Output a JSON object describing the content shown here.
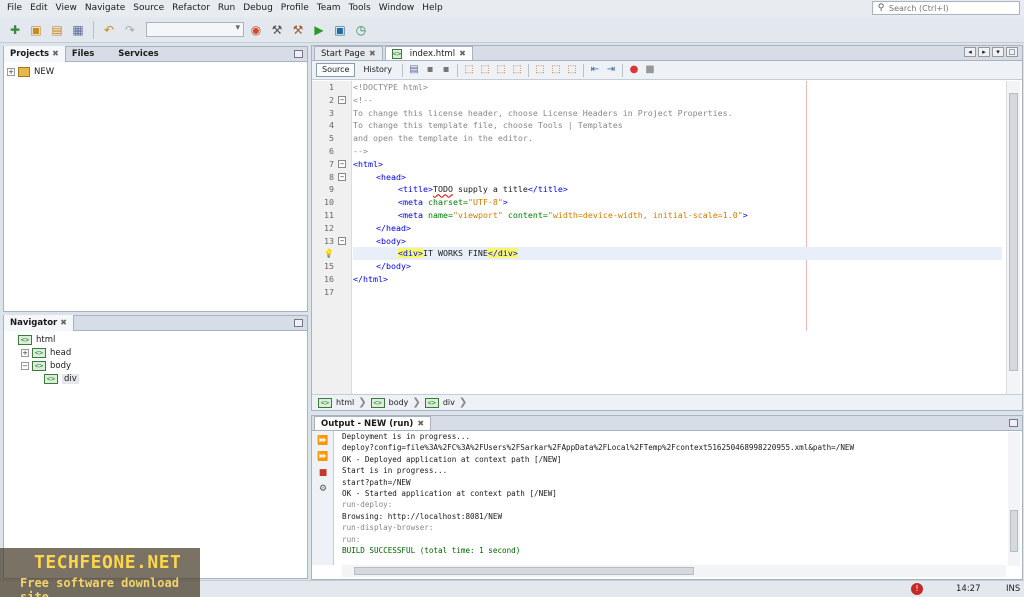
{
  "menu": [
    "File",
    "Edit",
    "View",
    "Navigate",
    "Source",
    "Refactor",
    "Run",
    "Debug",
    "Profile",
    "Team",
    "Tools",
    "Window",
    "Help"
  ],
  "search": {
    "placeholder": "Search (Ctrl+I)"
  },
  "projects_panel": {
    "tabs": [
      "Projects",
      "Files",
      "Services"
    ],
    "tree": [
      {
        "label": "NEW"
      }
    ]
  },
  "navigator": {
    "title": "Navigator",
    "tree": [
      {
        "label": "html"
      },
      {
        "label": "head"
      },
      {
        "label": "body"
      },
      {
        "label": "div"
      }
    ]
  },
  "editor": {
    "tabs": [
      "Start Page",
      "index.html"
    ],
    "active_tab": "index.html",
    "modes": [
      "Source",
      "History"
    ],
    "lines": [
      {
        "n": "1"
      },
      {
        "n": "2"
      },
      {
        "n": "3"
      },
      {
        "n": "4"
      },
      {
        "n": "5"
      },
      {
        "n": "6"
      },
      {
        "n": "7"
      },
      {
        "n": "8"
      },
      {
        "n": "9"
      },
      {
        "n": "10"
      },
      {
        "n": "11"
      },
      {
        "n": "12"
      },
      {
        "n": "13"
      },
      {
        "n": "14"
      },
      {
        "n": "15"
      },
      {
        "n": "16"
      },
      {
        "n": "17"
      }
    ],
    "code": {
      "l1": "<!DOCTYPE html>",
      "l2": "<!--",
      "l3": "To change this license header, choose License Headers in Project Properties.",
      "l4": "To change this template file, choose Tools | Templates",
      "l5": "and open the template in the editor.",
      "l6": "-->",
      "l7": "<html>",
      "l8_open": "<title>",
      "l8_todo": "TODO",
      "l8_text": " supply a title",
      "l8_close": "</title>",
      "l9_tag": "<meta ",
      "l9_attr": "charset=",
      "l9_val": "\"UTF-8\"",
      "l9_end": ">",
      "l10_tag": "<meta ",
      "l10_attr1": "name=",
      "l10_val1": "\"viewport\"",
      "l10_attr2": " content=",
      "l10_val2": "\"width=device-width, initial-scale=1.0\"",
      "l10_end": ">",
      "l_head_open": "<head>",
      "l_head_close": "</head>",
      "l_body_open": "<body>",
      "l_div_open": "<div>",
      "l_div_text": "IT WORKS FINE",
      "l_div_close": "</div>",
      "l_body_close": "</body>",
      "l_html_close": "</html>"
    },
    "breadcrumb": [
      "html",
      "body",
      "div"
    ]
  },
  "output": {
    "tab": "Output - NEW (run)",
    "lines": [
      {
        "text": "Deployment is in progress...",
        "style": "normal"
      },
      {
        "text": "deploy?config=file%3A%2FC%3A%2FUsers%2FSarkar%2FAppData%2FLocal%2FTemp%2Fcontext5162504689982209​55.xml&path=/NEW",
        "style": "normal"
      },
      {
        "text": "OK - Deployed application at context path [/NEW]",
        "style": "normal"
      },
      {
        "text": "Start is in progress...",
        "style": "normal"
      },
      {
        "text": "start?path=/NEW",
        "style": "normal"
      },
      {
        "text": "OK - Started application at context path [/NEW]",
        "style": "normal"
      },
      {
        "text": "run-deploy:",
        "style": "dim"
      },
      {
        "text": "Browsing: http://localhost:8081/NEW",
        "style": "normal"
      },
      {
        "text": "run-display-browser:",
        "style": "dim"
      },
      {
        "text": "run:",
        "style": "dim"
      },
      {
        "text": "BUILD SUCCESSFUL (total time: 1 second)",
        "style": "ok"
      }
    ]
  },
  "status": {
    "time": "14:27",
    "mode": "INS",
    "notification": "!"
  },
  "watermark": {
    "logo": "TECHFEONE.NET",
    "tagline": "Free software download site"
  }
}
